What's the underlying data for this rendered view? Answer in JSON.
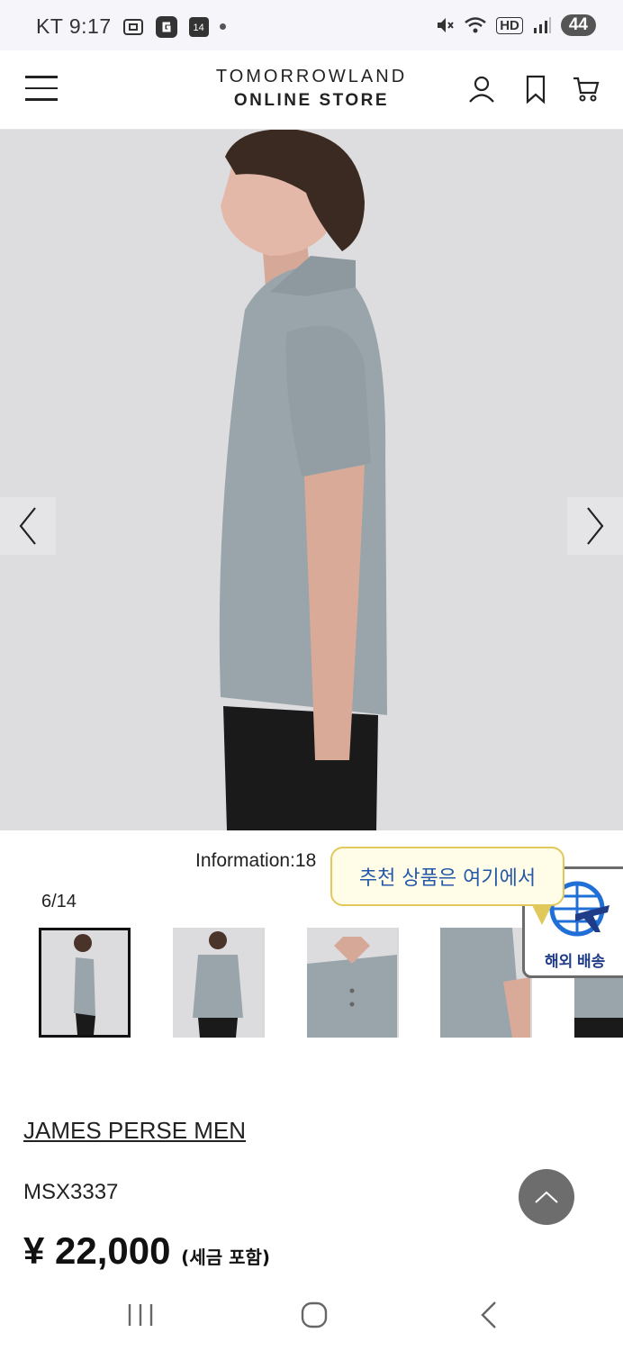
{
  "status_bar": {
    "carrier_time": "KT 9:17",
    "calendar_date": "14",
    "network": "HD",
    "battery": "44"
  },
  "header": {
    "logo_line1": "TOMORROWLAND",
    "logo_line2": "ONLINE STORE",
    "icons": [
      "menu-icon",
      "user-icon",
      "bookmark-icon",
      "cart-icon"
    ]
  },
  "gallery": {
    "counter": "6/14",
    "information": "Information:18"
  },
  "overseas": {
    "bubble_text": "추천 상품은 여기에서",
    "label": "해외 배송"
  },
  "product": {
    "brand": "JAMES PERSE MEN",
    "sku": "MSX3337",
    "price": "¥ 22,000",
    "price_note": "(세금 포함)"
  },
  "colors": {
    "shirt": "#9aa5ab",
    "background": "#dddddf",
    "bubble_text": "#2458a8",
    "overseas_label": "#1f3c88"
  }
}
